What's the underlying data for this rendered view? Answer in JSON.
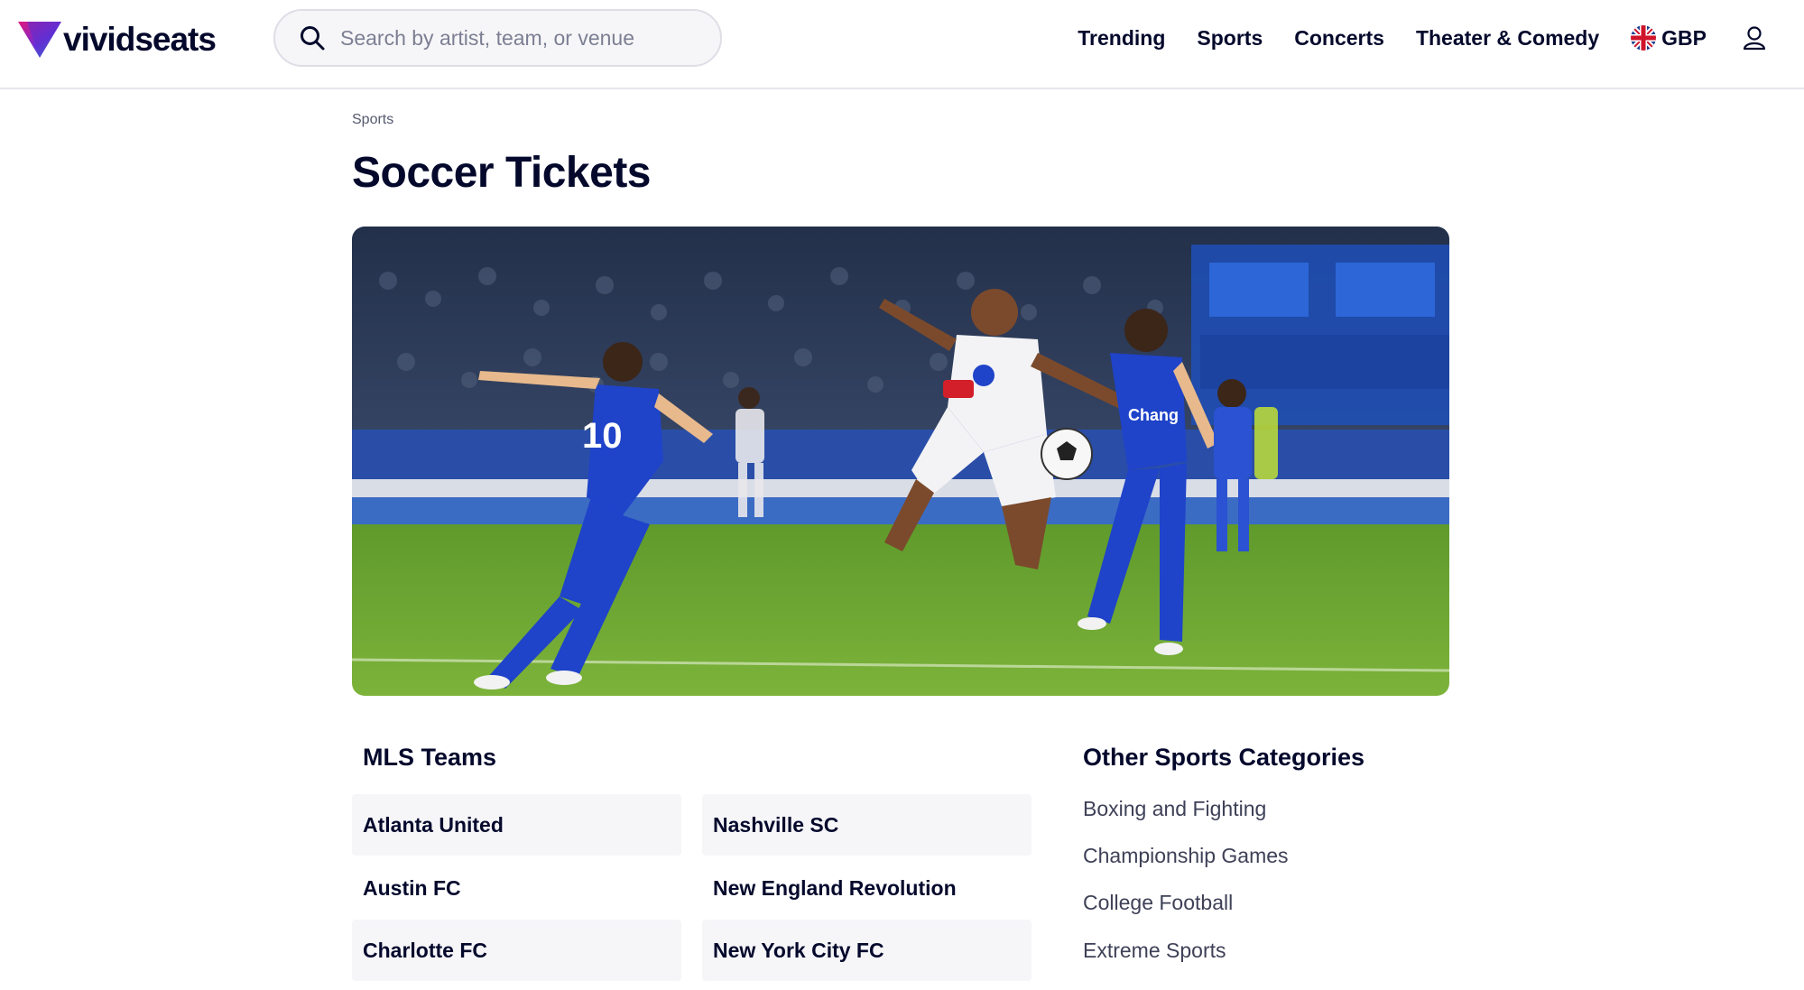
{
  "header": {
    "logo_text": "vividseats",
    "search": {
      "placeholder": "Search by artist, team, or venue",
      "value": ""
    },
    "nav": [
      "Trending",
      "Sports",
      "Concerts",
      "Theater & Comedy"
    ],
    "currency": "GBP",
    "icons": {
      "search": "search-icon",
      "flag": "uk-flag-icon",
      "user": "user-icon"
    }
  },
  "breadcrumb": "Sports",
  "page_title": "Soccer Tickets",
  "hero_image_alt": "Soccer players in blue and white kits competing for the ball in a stadium",
  "mls": {
    "title": "MLS Teams",
    "column_left": [
      "Atlanta United",
      "Austin FC",
      "Charlotte FC"
    ],
    "column_right": [
      "Nashville SC",
      "New England Revolution",
      "New York City FC"
    ]
  },
  "other": {
    "title": "Other Sports Categories",
    "items": [
      "Boxing and Fighting",
      "Championship Games",
      "College Football",
      "Extreme Sports"
    ]
  },
  "colors": {
    "brand_navy": "#04092c",
    "brand_purple": "#6b2ed8",
    "brand_pink": "#e2177d",
    "card_bg": "#f6f6f9"
  }
}
